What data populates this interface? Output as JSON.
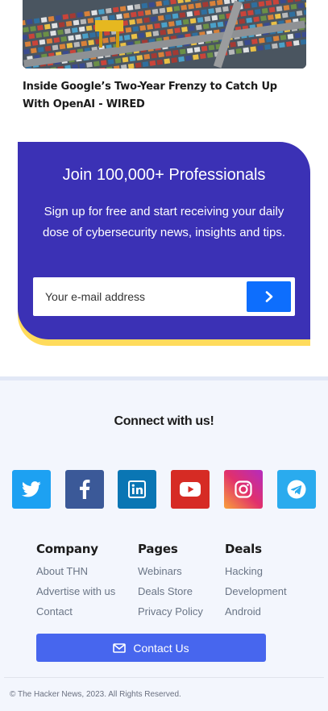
{
  "article": {
    "title": "Inside Google’s Two-Year Frenzy to Catch Up With OpenAI - WIRED",
    "image_icon": "shipping-containers-photo"
  },
  "newsletter": {
    "title": "Join 100,000+ Professionals",
    "description": "Sign up for free and start receiving your daily dose of cybersecurity news, insights and tips.",
    "email_placeholder": "Your e-mail address",
    "submit_icon": "chevron-right-icon",
    "colors": {
      "background": "#3b31b5",
      "accent": "#ffdb5c",
      "button": "#0d6efd"
    }
  },
  "footer": {
    "connect_title": "Connect with us!",
    "socials": [
      {
        "name": "Twitter",
        "icon": "twitter-icon",
        "color": "#1da1f2"
      },
      {
        "name": "Facebook",
        "icon": "facebook-icon",
        "color": "#3b5998"
      },
      {
        "name": "LinkedIn",
        "icon": "linkedin-icon",
        "color": "#0a76b4"
      },
      {
        "name": "YouTube",
        "icon": "youtube-icon",
        "color": "#d62b24"
      },
      {
        "name": "Instagram",
        "icon": "instagram-icon",
        "color": "#e1306c"
      },
      {
        "name": "Telegram",
        "icon": "telegram-icon",
        "color": "#2aabee"
      }
    ],
    "columns": [
      {
        "heading": "Company",
        "links": [
          "About THN",
          "Advertise with us",
          "Contact"
        ]
      },
      {
        "heading": "Pages",
        "links": [
          "Webinars",
          "Deals Store",
          "Privacy Policy"
        ]
      },
      {
        "heading": "Deals",
        "links": [
          "Hacking",
          "Development",
          "Android"
        ]
      }
    ],
    "contact_button": {
      "label": "Contact Us",
      "icon": "envelope-icon",
      "color": "#4766ee"
    },
    "copyright": "© The Hacker News, 2023. All Rights Reserved."
  }
}
